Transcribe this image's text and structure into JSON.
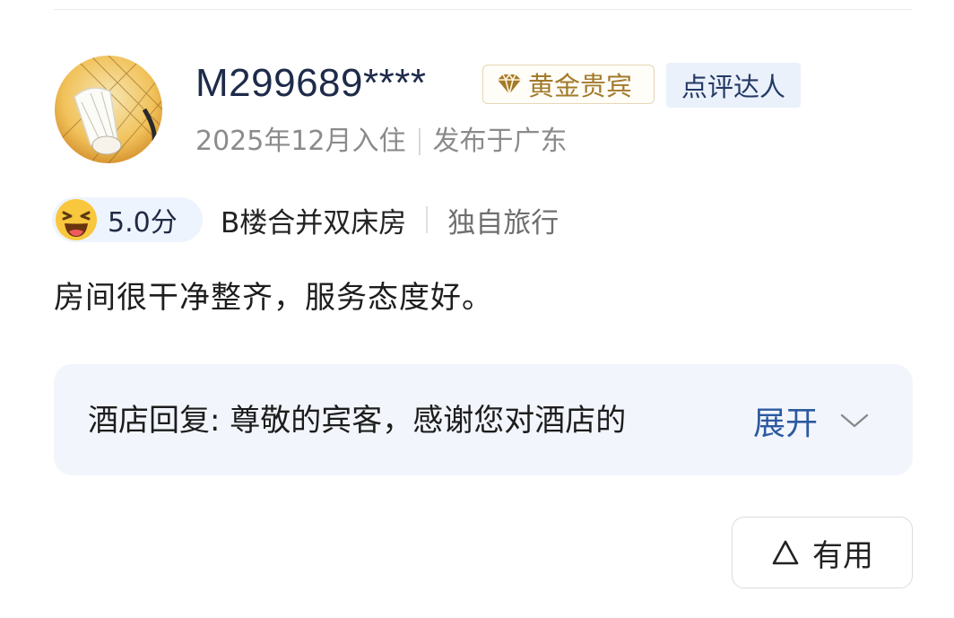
{
  "review": {
    "username": "M299689****",
    "badges": {
      "gold_label": "黄金贵宾",
      "expert_label": "点评达人"
    },
    "stay_date": "2025年12月入住",
    "location": "发布于广东",
    "score": "5.0分",
    "room_type": "B楼合并双床房",
    "trip_type": "独自旅行",
    "text": "房间很干净整齐，服务态度好。"
  },
  "reply": {
    "text": "酒店回复: 尊敬的宾客，感谢您对酒店的",
    "expand_label": "展开"
  },
  "actions": {
    "helpful_label": "有用"
  },
  "colors": {
    "accent_blue": "#2c5aa0",
    "gold": "#a37a2b",
    "reply_bg": "#f2f6fc"
  },
  "icons": [
    "avatar-image",
    "diamond-icon",
    "laughing-emoji-icon",
    "chevron-down-icon",
    "triangle-icon"
  ]
}
